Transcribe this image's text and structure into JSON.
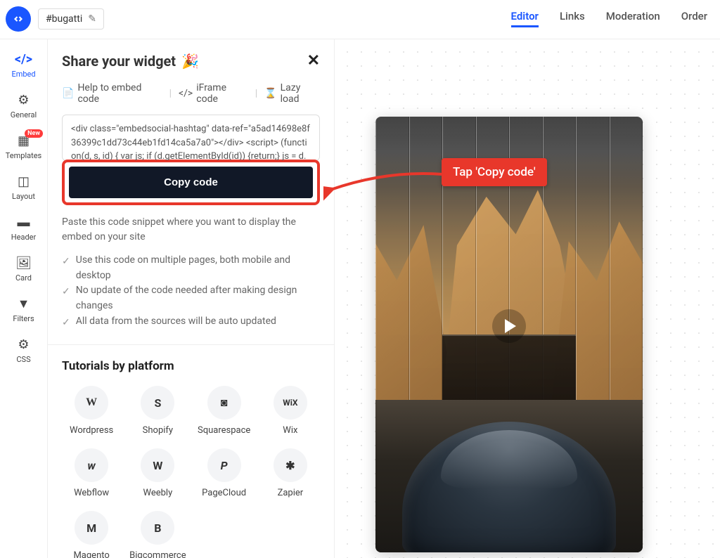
{
  "header": {
    "hashtag": "#bugatti",
    "tabs": [
      "Editor",
      "Links",
      "Moderation",
      "Order"
    ],
    "active_tab_index": 0
  },
  "sidebar": {
    "items": [
      {
        "label": "Embed",
        "icon": "</>",
        "active": true
      },
      {
        "label": "General",
        "icon": "gear"
      },
      {
        "label": "Templates",
        "icon": "grid",
        "badge": "New"
      },
      {
        "label": "Layout",
        "icon": "layout"
      },
      {
        "label": "Header",
        "icon": "rect"
      },
      {
        "label": "Card",
        "icon": "image"
      },
      {
        "label": "Filters",
        "icon": "funnel"
      },
      {
        "label": "CSS",
        "icon": "gear"
      }
    ]
  },
  "panel": {
    "title": "Share your widget",
    "help": {
      "embed": "Help to embed code",
      "iframe": "iFrame code",
      "lazy": "Lazy load"
    },
    "code_snippet": "<div class=\"embedsocial-hashtag\" data-ref=\"a5ad14698e8f36399c1dd73c44eb1fd14ca5a7a0\"></div> <script> (function(d, s, id) { var js; if (d.getElementById(id)) {return;} js = d.createElement(s); js.id = id; js.src = \"https://embedsocia",
    "copy_button": "Copy code",
    "paste_hint": "Paste this code snippet where you want to display the embed on your site",
    "checks": [
      "Use this code on multiple pages, both mobile and desktop",
      "No update of the code needed after making design changes",
      "All data from the sources will be auto updated"
    ],
    "tutorials_title": "Tutorials by platform",
    "platforms": [
      {
        "name": "Wordpress",
        "glyph": "W"
      },
      {
        "name": "Shopify",
        "glyph": "S"
      },
      {
        "name": "Squarespace",
        "glyph": "◙"
      },
      {
        "name": "Wix",
        "glyph": "WiX"
      },
      {
        "name": "Webflow",
        "glyph": "w"
      },
      {
        "name": "Weebly",
        "glyph": "W"
      },
      {
        "name": "PageCloud",
        "glyph": "P"
      },
      {
        "name": "Zapier",
        "glyph": "✱"
      },
      {
        "name": "Magento",
        "glyph": "M"
      },
      {
        "name": "Bigcommerce",
        "glyph": "B"
      }
    ]
  },
  "callout": {
    "text": "Tap 'Copy code'"
  }
}
